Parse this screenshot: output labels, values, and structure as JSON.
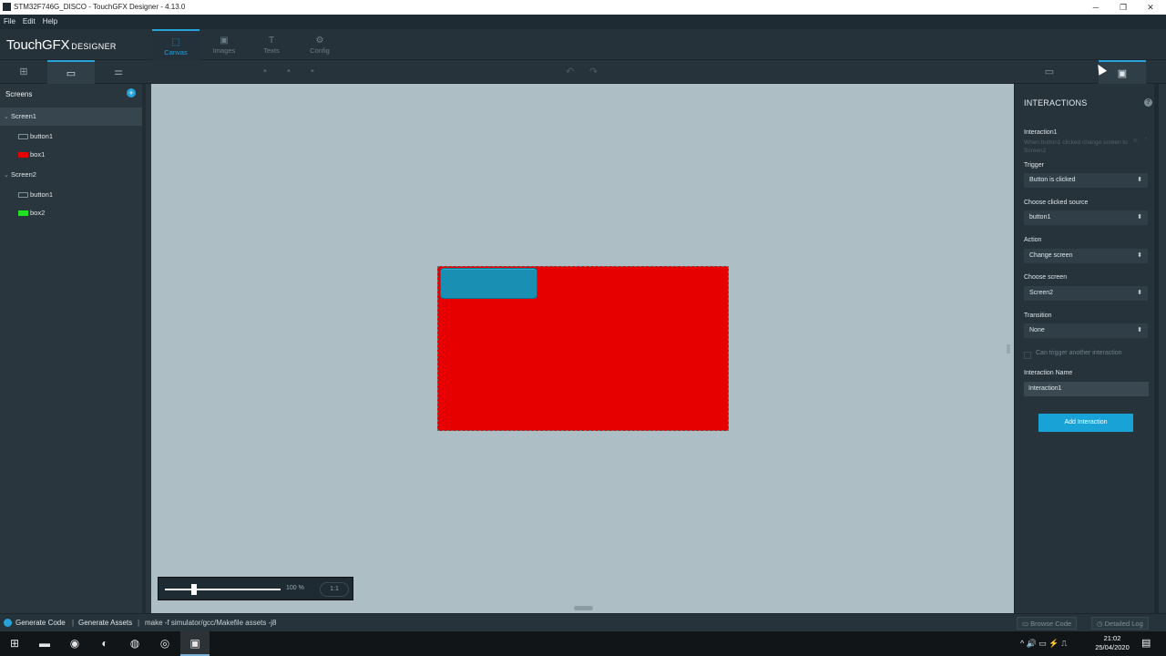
{
  "window": {
    "title": "STM32F746G_DISCO - TouchGFX Designer - 4.13.0",
    "min": "─",
    "max": "❐",
    "close": "✕"
  },
  "menu": [
    "File",
    "Edit",
    "Help"
  ],
  "logo": {
    "main": "TouchGFX",
    "sub": "DESIGNER"
  },
  "nav": [
    {
      "label": "Canvas",
      "icon": "canvas-icon",
      "glyph": "⬚",
      "active": true
    },
    {
      "label": "Images",
      "icon": "images-icon",
      "glyph": "▣",
      "active": false
    },
    {
      "label": "Texts",
      "icon": "texts-icon",
      "glyph": "T",
      "active": false
    },
    {
      "label": "Config",
      "icon": "config-icon",
      "glyph": "⚙",
      "active": false
    }
  ],
  "toolbar": {
    "left_tabs": [
      {
        "icon": "add-widget-icon",
        "glyph": "⊞"
      },
      {
        "icon": "screen-select-icon",
        "glyph": "▭",
        "active": true
      },
      {
        "icon": "properties-icon",
        "glyph": "⚌"
      }
    ],
    "undo": "↶",
    "redo": "↷",
    "right_tabs": [
      {
        "icon": "properties-panel-icon",
        "glyph": "▭"
      },
      {
        "icon": "interactions-panel-icon",
        "glyph": "▣",
        "active": true
      }
    ]
  },
  "screens": {
    "header": "Screens",
    "add": "+",
    "tree": [
      {
        "label": "Screen1",
        "type": "screen",
        "selected": true
      },
      {
        "label": "button1",
        "type": "button"
      },
      {
        "label": "box1",
        "type": "box",
        "color": "#e60000"
      },
      {
        "label": "Screen2",
        "type": "screen"
      },
      {
        "label": "button1",
        "type": "button"
      },
      {
        "label": "box2",
        "type": "box",
        "color": "#22e022"
      }
    ]
  },
  "canvas": {
    "background": "#aebec5",
    "screen_color": "#e60000",
    "button_color": "#1990b3"
  },
  "zoom": {
    "value": "100 %",
    "ratio_button": "1:1",
    "level": 0.25
  },
  "interactions": {
    "title": "INTERACTIONS",
    "help": "?",
    "item_name": "Interaction1",
    "item_desc": "When button1 clicked change screen to Screen2",
    "close": "✕",
    "collapse": "⌃",
    "trigger_label": "Trigger",
    "trigger_value": "Button is clicked",
    "source_label": "Choose clicked source",
    "source_value": "button1",
    "action_label": "Action",
    "action_value": "Change screen",
    "screen_label": "Choose screen",
    "screen_value": "Screen2",
    "transition_label": "Transition",
    "transition_value": "None",
    "checkbox_label": "Can trigger another interaction",
    "name_label": "Interaction Name",
    "name_value": "Interaction1",
    "add_button": "Add Interaction",
    "arrow": "⬍"
  },
  "status": {
    "generate": "Generate Code",
    "sep": "|",
    "assets": "Generate Assets",
    "command": "make -f simulator/gcc/Makefile assets -j8",
    "browse": "Browse Code",
    "log": "Detailed Log"
  },
  "taskbar": {
    "apps": [
      {
        "icon": "windows-start-icon",
        "glyph": "⊞"
      },
      {
        "icon": "file-explorer-icon",
        "glyph": "▬"
      },
      {
        "icon": "firefox-icon",
        "glyph": "◉"
      },
      {
        "icon": "eclipse-icon",
        "glyph": "◐"
      },
      {
        "icon": "chrome-icon",
        "glyph": "◍"
      },
      {
        "icon": "obs-icon",
        "glyph": "◎"
      },
      {
        "icon": "touchgfx-icon",
        "glyph": "▣",
        "active": true
      }
    ],
    "tray": "^  🔊  ▭  ⚡  ⎍",
    "time": "21:02",
    "date": "25/04/2020",
    "notif": "▤"
  }
}
